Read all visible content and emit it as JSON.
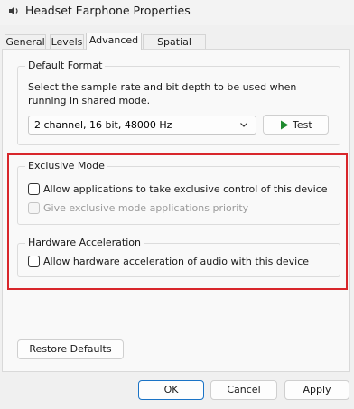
{
  "window": {
    "title": "Headset Earphone Properties",
    "app_icon": "speaker-icon"
  },
  "tabs": [
    {
      "label": "General",
      "active": false
    },
    {
      "label": "Levels",
      "active": false
    },
    {
      "label": "Advanced",
      "active": true
    },
    {
      "label": "Spatial sound",
      "active": false
    }
  ],
  "default_format": {
    "legend": "Default Format",
    "description": "Select the sample rate and bit depth to be used when running in shared mode.",
    "selected_format": "2 channel, 16 bit, 48000 Hz",
    "test_label": "Test",
    "test_icon": "play-icon",
    "test_icon_color": "#1e8a2e"
  },
  "exclusive_mode": {
    "legend": "Exclusive Mode",
    "allow_exclusive_label": "Allow applications to take exclusive control of this device",
    "allow_exclusive_checked": false,
    "priority_label": "Give exclusive mode applications priority",
    "priority_checked": false,
    "priority_enabled": false
  },
  "hardware_acceleration": {
    "legend": "Hardware Acceleration",
    "allow_hw_label": "Allow hardware acceleration of audio with this device",
    "allow_hw_checked": false
  },
  "restore_defaults_label": "Restore Defaults",
  "footer": {
    "ok_label": "OK",
    "cancel_label": "Cancel",
    "apply_label": "Apply"
  },
  "colors": {
    "highlight_border": "#d8262b",
    "primary_button_border": "#1a73c6"
  }
}
